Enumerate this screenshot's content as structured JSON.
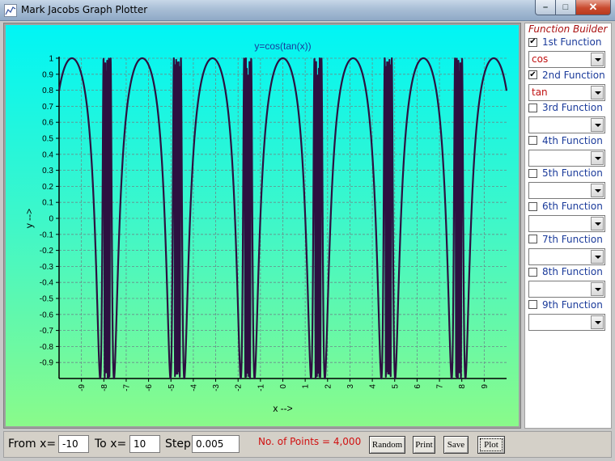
{
  "window": {
    "title": "Mark Jacobs Graph Plotter",
    "min_glyph": "–",
    "max_glyph": "□",
    "close_glyph": "✕"
  },
  "chart_data": {
    "type": "line",
    "title": "y=cos(tan(x))",
    "xlabel": "x -->",
    "ylabel": "y -->",
    "xlim": [
      -10,
      10
    ],
    "ylim": [
      -1,
      1
    ],
    "x_ticks": [
      -9,
      -8,
      -7,
      -6,
      -5,
      -4,
      -3,
      -2,
      -1,
      0,
      1,
      2,
      3,
      4,
      5,
      6,
      7,
      8,
      9
    ],
    "y_ticks": [
      1,
      0.9,
      0.8,
      0.7,
      0.6,
      0.5,
      0.4,
      0.3,
      0.2,
      0.1,
      0,
      -0.1,
      -0.2,
      -0.3,
      -0.4,
      -0.5,
      -0.6,
      -0.7,
      -0.8,
      -0.9
    ],
    "grid": true,
    "line_color": "#2d1040",
    "series": [
      {
        "function": "cos(tan(x))",
        "from": -10,
        "to": 10,
        "step": 0.005
      }
    ]
  },
  "function_builder": {
    "title": "Function Builder",
    "functions": [
      {
        "label": "1st Function",
        "checked": true,
        "value": "cos"
      },
      {
        "label": "2nd Function",
        "checked": true,
        "value": "tan"
      },
      {
        "label": "3rd Function",
        "checked": false,
        "value": ""
      },
      {
        "label": "4th Function",
        "checked": false,
        "value": ""
      },
      {
        "label": "5th Function",
        "checked": false,
        "value": ""
      },
      {
        "label": "6th Function",
        "checked": false,
        "value": ""
      },
      {
        "label": "7th Function",
        "checked": false,
        "value": ""
      },
      {
        "label": "8th Function",
        "checked": false,
        "value": ""
      },
      {
        "label": "9th Function",
        "checked": false,
        "value": ""
      }
    ]
  },
  "controls": {
    "from_label": "From x=",
    "from_value": "-10",
    "to_label": "To x=",
    "to_value": "10",
    "step_label": "Step",
    "step_value": "0.005",
    "points_text": "No. of Points = 4,000",
    "random_label": "Random",
    "print_label": "Print",
    "save_label": "Save",
    "plot_label": "Plot"
  },
  "check_glyph": "✔"
}
